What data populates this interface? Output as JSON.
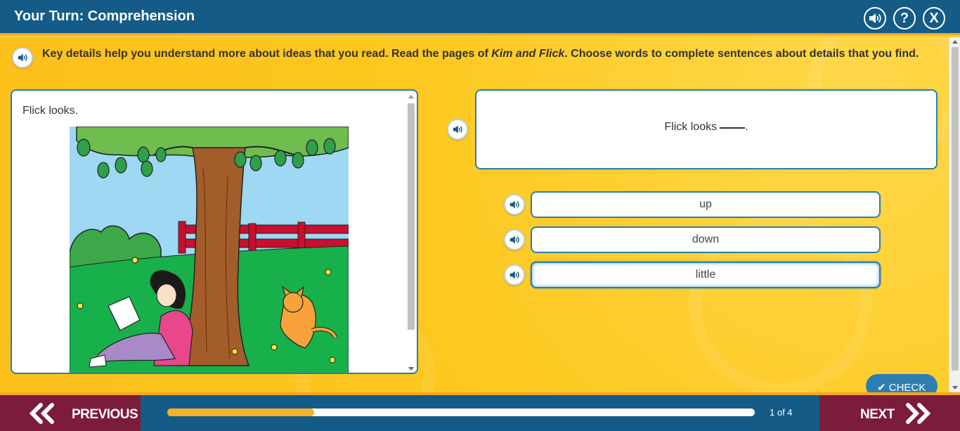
{
  "header": {
    "title": "Your Turn: Comprehension",
    "help_label": "?",
    "close_label": "X"
  },
  "instructions": {
    "before": "Key details help you understand more about ideas that you read. Read the pages of ",
    "book_title": "Kim and Flick",
    "after": ". Choose words to complete sentences about details that you find."
  },
  "reader": {
    "text": "Flick looks."
  },
  "question": {
    "prompt": "Flick looks",
    "end": "."
  },
  "choices": [
    {
      "label": "up"
    },
    {
      "label": "down"
    },
    {
      "label": "little"
    }
  ],
  "check": {
    "label": "CHECK"
  },
  "footer": {
    "previous_label": "PREVIOUS",
    "next_label": "NEXT",
    "pager": "1 of 4",
    "progress": 0.25
  },
  "colors": {
    "header_bg": "#155b87",
    "accent": "#f6a623",
    "nav_bg": "#7b1c3a",
    "panel_border": "#2a7fa8"
  }
}
